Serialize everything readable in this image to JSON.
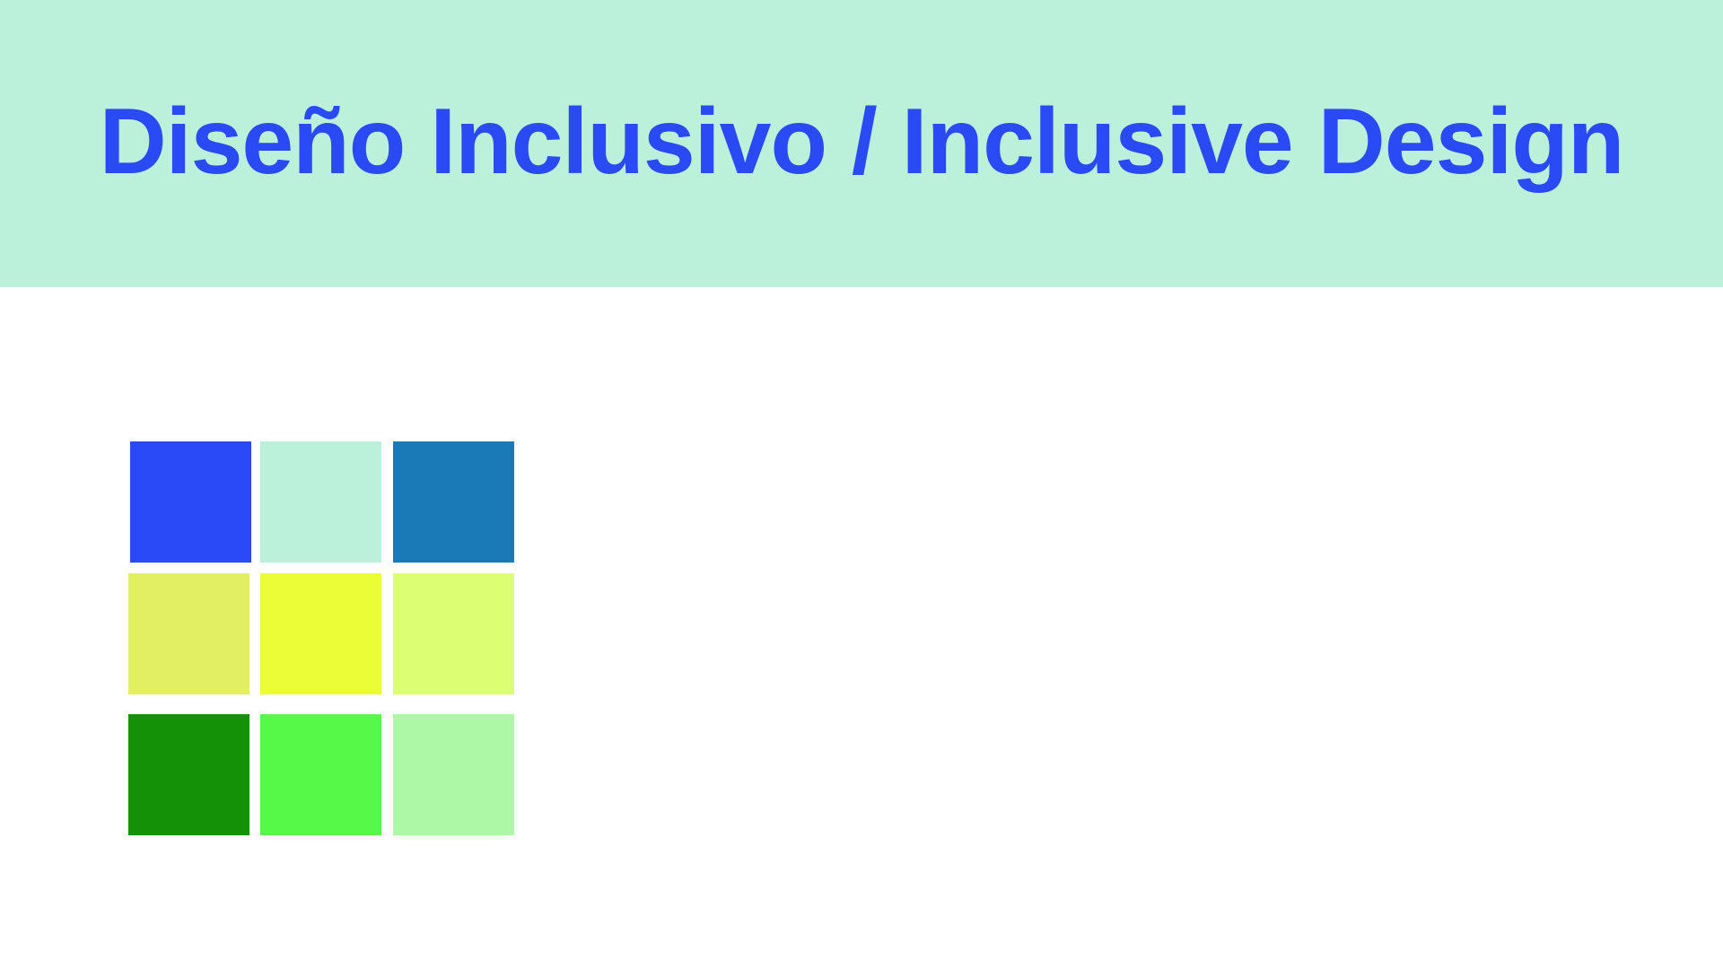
{
  "header": {
    "title": "Diseño Inclusivo / Inclusive Design",
    "background_color": "#bbf0db",
    "title_color": "#2a4af5"
  },
  "palette": {
    "swatches": [
      {
        "color": "#2a4af7"
      },
      {
        "color": "#bbf0db"
      },
      {
        "color": "#1a7ab8"
      },
      {
        "color": "#e3ef63"
      },
      {
        "color": "#eafd36"
      },
      {
        "color": "#dbfe72"
      },
      {
        "color": "#159107"
      },
      {
        "color": "#57f948"
      },
      {
        "color": "#adf8a7"
      }
    ]
  }
}
